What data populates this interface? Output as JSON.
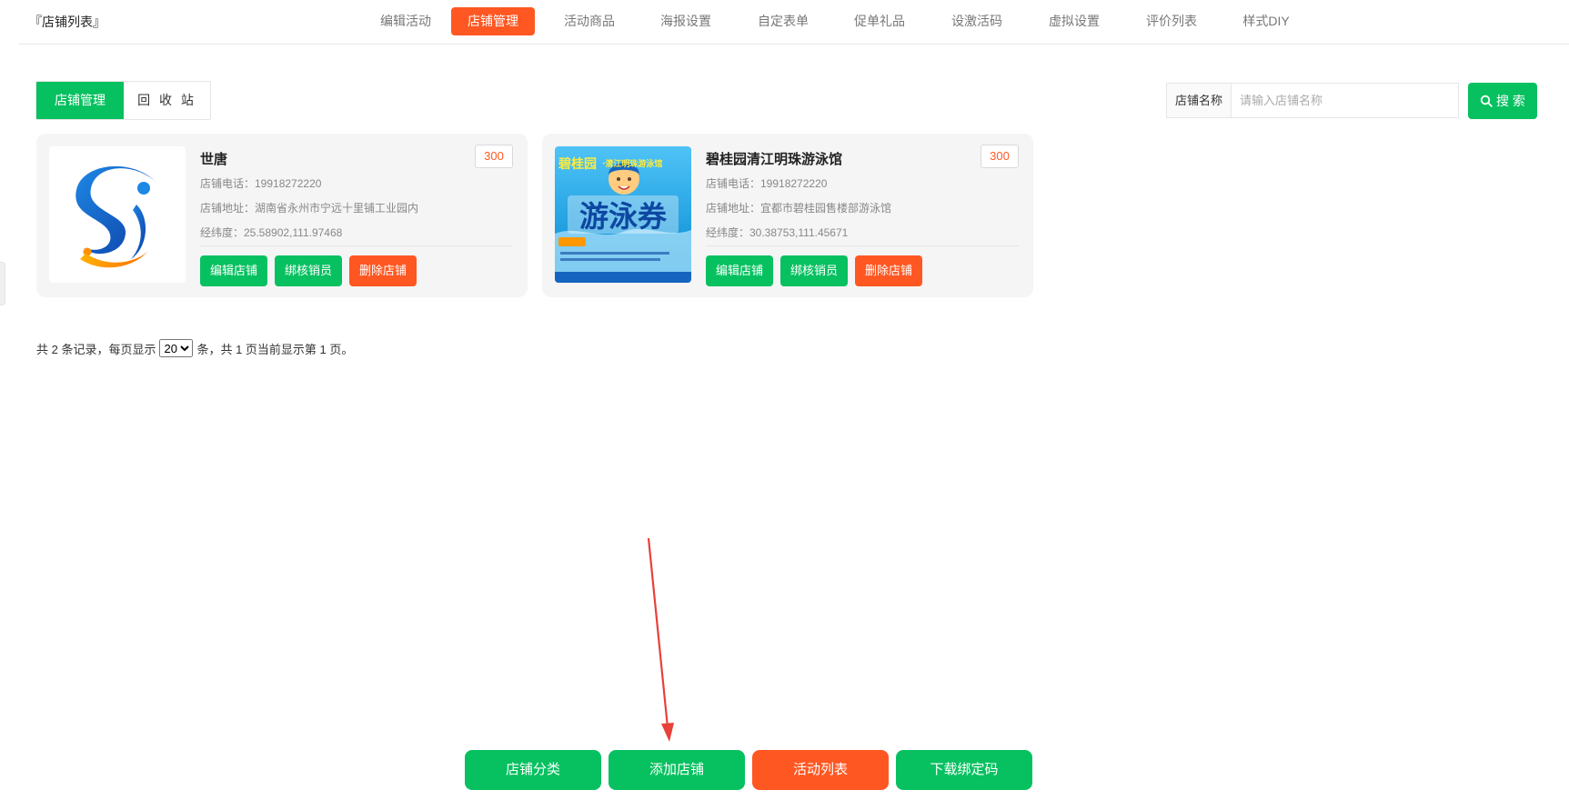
{
  "page_title": "『店铺列表』",
  "nav_tabs": [
    {
      "label": "编辑活动"
    },
    {
      "label": "店铺管理"
    },
    {
      "label": "活动商品"
    },
    {
      "label": "海报设置"
    },
    {
      "label": "自定表单"
    },
    {
      "label": "促单礼品"
    },
    {
      "label": "设激活码"
    },
    {
      "label": "虚拟设置"
    },
    {
      "label": "评价列表"
    },
    {
      "label": "样式DIY"
    }
  ],
  "active_tab": "店铺管理",
  "segment": {
    "store_manage": "店铺管理",
    "recycle_bin": "回 收 站"
  },
  "search": {
    "label": "店铺名称",
    "placeholder": "请输入店铺名称",
    "value": "",
    "button": "搜 索"
  },
  "stores": [
    {
      "name": "世唐",
      "badge": "300",
      "phone": "店铺电话：19918272220",
      "address": "店铺地址：湖南省永州市宁远十里铺工业园内",
      "coords": "经纬度：25.58902,111.97468",
      "logo_icon": "swimmer-logo-icon"
    },
    {
      "name": "碧桂园清江明珠游泳馆",
      "badge": "300",
      "phone": "店铺电话：19918272220",
      "address": "店铺地址：宜都市碧桂园售楼部游泳馆",
      "coords": "经纬度：30.38753,111.45671",
      "poster": {
        "brand": "碧桂园",
        "subtitle": "·清江明珠游泳馆",
        "big": "游泳券"
      }
    }
  ],
  "card_buttons": {
    "edit": "编辑店铺",
    "verify": "绑核销员",
    "delete": "删除店铺"
  },
  "pagination": {
    "prefix": "共 2 条记录，每页显示",
    "per_page": "20",
    "suffix": "条，共 1 页当前显示第 1 页。"
  },
  "bottom_buttons": {
    "category": "店铺分类",
    "add": "添加店铺",
    "activity": "活动列表",
    "download": "下载绑定码"
  },
  "colors": {
    "green": "#07c160",
    "orange": "#ff5722",
    "annotation_arrow": "#e8403a"
  }
}
